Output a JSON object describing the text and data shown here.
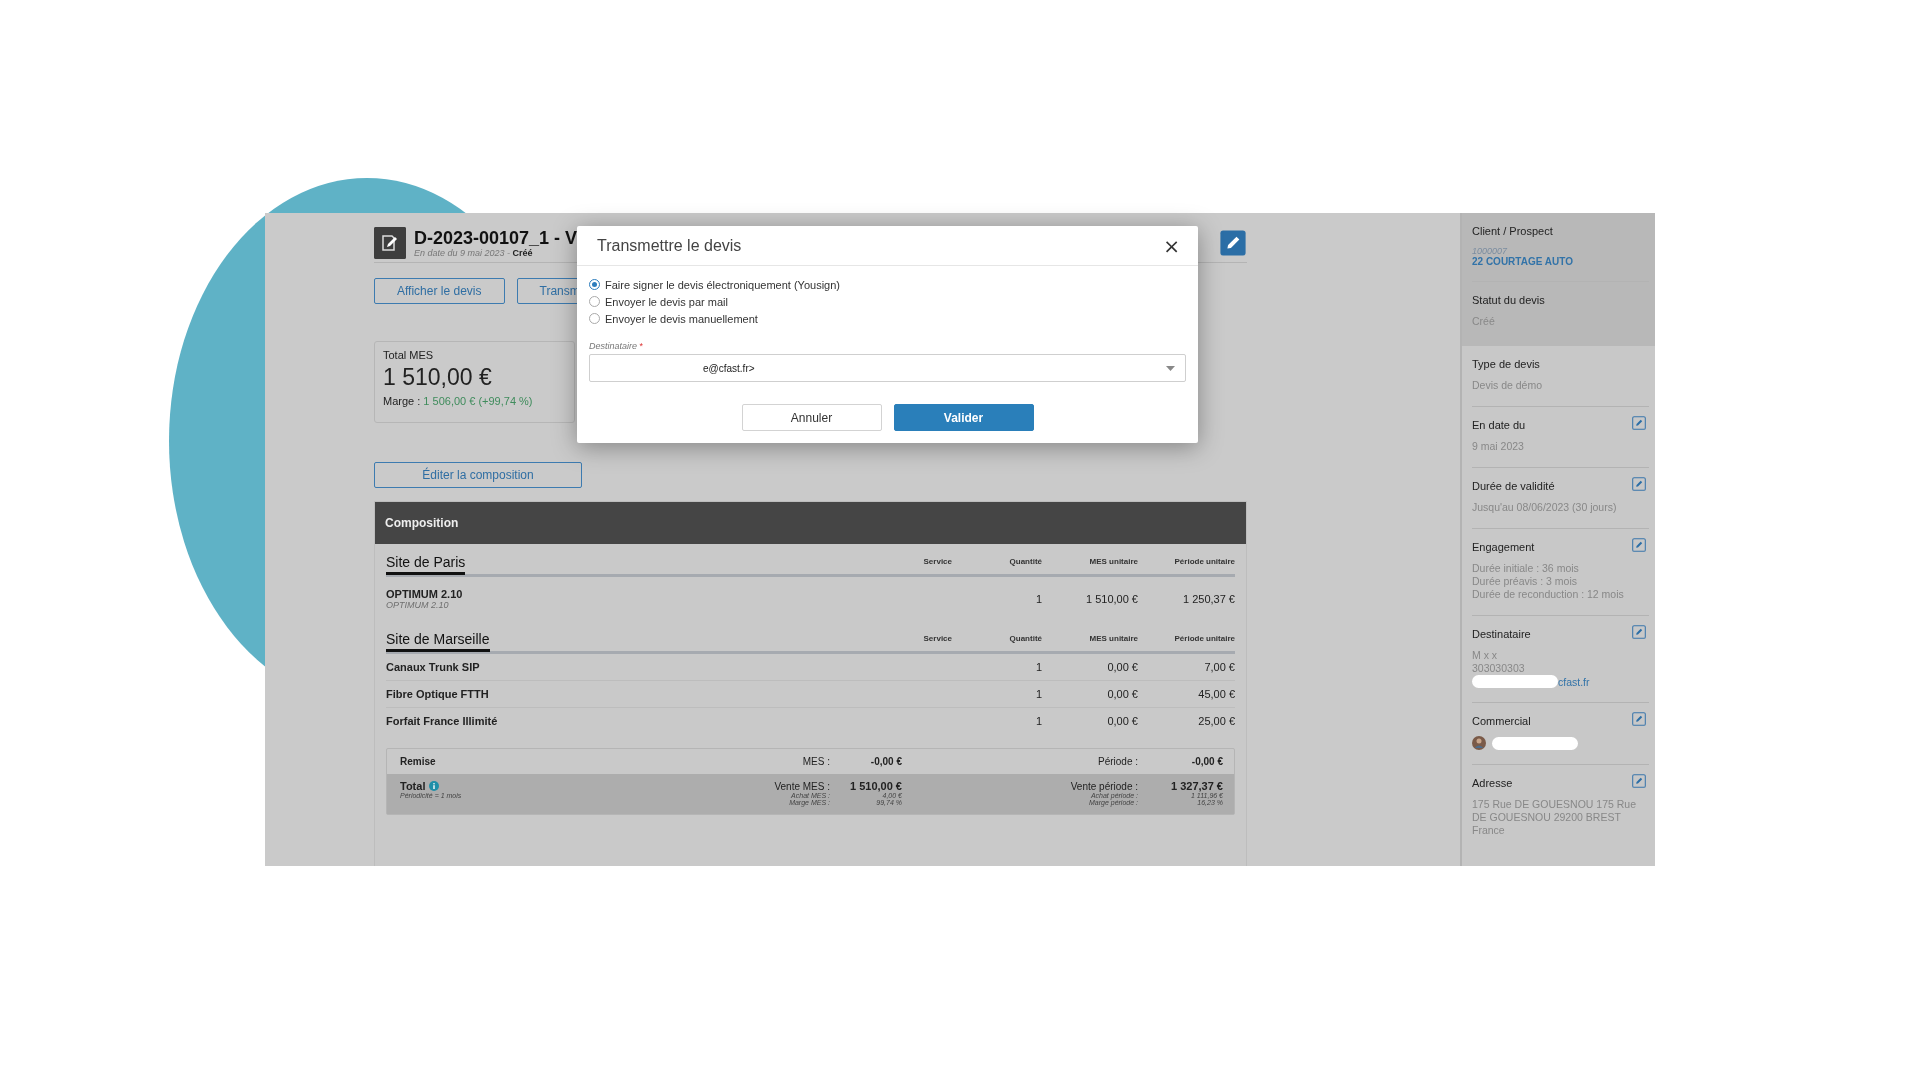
{
  "header": {
    "title": "D-2023-00107_1 - V",
    "subtitle": "*En date du 9 mai 2023* - **Créé**"
  },
  "actions": [
    {
      "label": "Afficher le devis"
    },
    {
      "label": "Transm"
    }
  ],
  "total_card": {
    "label": "Total MES",
    "amount": "1 510,00 €",
    "margin_label": "Marge :",
    "margin_value": "1 506,00 € (+99,74 %)"
  },
  "edit_composition": "Éditer la composition",
  "composition": {
    "title": "Composition",
    "sites": [
      {
        "name": "Site de Paris",
        "columns": [
          "Service",
          "Quantité",
          "MES unitaire",
          "Période unitaire"
        ],
        "rows": [
          {
            "name": "OPTIMUM 2.10",
            "subtitle": "OPTIMUM 2.10",
            "quantity": "1",
            "mes": "1 510,00 €",
            "periode": "1 250,37 €"
          }
        ]
      },
      {
        "name": "Site de Marseille",
        "columns": [
          "Service",
          "Quantité",
          "MES unitaire",
          "Période unitaire"
        ],
        "rows": [
          {
            "name": "Canaux Trunk SIP",
            "quantity": "1",
            "mes": "0,00 €",
            "periode": "7,00 €"
          },
          {
            "name": "Fibre Optique FTTH",
            "quantity": "1",
            "mes": "0,00 €",
            "periode": "45,00 €"
          },
          {
            "name": "Forfait France Illimité",
            "quantity": "1",
            "mes": "0,00 €",
            "periode": "25,00 €"
          }
        ]
      }
    ],
    "remise": {
      "label": "Remise",
      "mes_label": "MES :",
      "mes_value": "-0,00 €",
      "periode_label": "Période :",
      "periode_value": "-0,00 €"
    },
    "total": {
      "label": "Total",
      "note": "Périodicité = 1 mois",
      "mes_lines": [
        {
          "label": "Vente MES :",
          "value": "1 510,00 €",
          "kind": "main"
        },
        {
          "label": "Achat MES :",
          "value": "4,00 €",
          "kind": "detail"
        },
        {
          "label": "Marge MES :",
          "value": "99,74 %",
          "kind": "detail"
        }
      ],
      "periode_lines": [
        {
          "label": "Vente période :",
          "value": "1 327,37 €",
          "kind": "main"
        },
        {
          "label": "Achat période :",
          "value": "1 111,96 €",
          "kind": "detail"
        },
        {
          "label": "Marge période :",
          "value": "16,23 %",
          "kind": "detail"
        }
      ]
    }
  },
  "sidebar": {
    "summary": [
      {
        "label": "Client / Prospect",
        "code": "1000007",
        "link": "22 COURTAGE AUTO",
        "editable": false
      },
      {
        "label": "Statut du devis",
        "lines": [
          "Créé"
        ],
        "editable": false
      }
    ],
    "details": [
      {
        "label": "Type de devis",
        "lines": [
          "Devis de démo"
        ],
        "editable": false
      },
      {
        "label": "En date du",
        "lines": [
          "9 mai 2023"
        ],
        "editable": true
      },
      {
        "label": "Durée de validité",
        "lines": [
          "Jusqu'au 08/06/2023 (30 jours)"
        ],
        "editable": true
      },
      {
        "label": "Engagement",
        "lines": [
          "Durée initiale : 36 mois",
          "Durée préavis : 3 mois",
          "Durée de reconduction : 12 mois"
        ],
        "editable": true
      },
      {
        "label": "Destinataire",
        "lines": [
          "M x x",
          "303030303"
        ],
        "email": "cfast.fr",
        "editable": true
      },
      {
        "label": "Commercial",
        "person": true,
        "editable": true
      },
      {
        "label": "Adresse",
        "lines": [
          "175 Rue DE GOUESNOU 175 Rue DE GOUESNOU 29200 BREST France"
        ],
        "editable": true
      }
    ]
  },
  "dialog": {
    "title": "Transmettre le devis",
    "close": "×",
    "options": [
      {
        "label": "Faire signer le devis électroniquement (Yousign)",
        "selected": true
      },
      {
        "label": "Envoyer le devis par mail",
        "selected": false
      },
      {
        "label": "Envoyer le devis manuellement",
        "selected": false
      }
    ],
    "field": {
      "label": "Destinataire",
      "required": "*",
      "value": "e@cfast.fr>"
    },
    "buttons": [
      {
        "label": "Annuler",
        "kind": "secondary"
      },
      {
        "label": "Valider",
        "kind": "primary"
      }
    ]
  }
}
